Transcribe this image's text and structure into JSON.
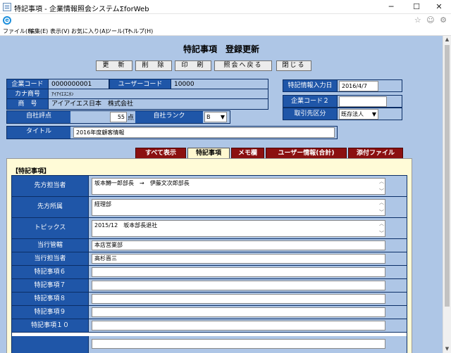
{
  "window": {
    "title": "特記事項 - 企業情報照会システムΣforWeb",
    "minimize": "─",
    "maximize": "☐",
    "close": "✕"
  },
  "browser": {
    "icons": "☆ ☺ ⚙"
  },
  "menu": [
    "ファイル(F)",
    "編集(E)",
    "表示(V)",
    "お気に入り(A)",
    "ツール(T)",
    "ヘルプ(H)"
  ],
  "page": {
    "title": "特記事項　登録更新"
  },
  "toolbar": {
    "update": "更　新",
    "delete": "削　除",
    "print": "印　刷",
    "back": "照会へ戻る",
    "close": "閉じる"
  },
  "company": {
    "code_label": "企業コード",
    "code": "0000000001",
    "user_code_label": "ユーザーコード",
    "user_code": "10000",
    "kana_label": "カナ商号",
    "kana": "ｱｲｱｲｴｽﾆﾎﾝ",
    "name_label": "商　号",
    "name": "アイアイエス日本　株式会社",
    "self_score_label": "自社評点",
    "self_score": "55",
    "score_unit": "点",
    "rank_label": "自社ランク",
    "rank": "B",
    "title_label": "タイトル",
    "title": "2016年度顧客情報"
  },
  "side": {
    "date_label": "特記情報入力日",
    "date": "2016/4/7",
    "code2_label": "企業コード２",
    "code2": "",
    "partner_label": "取引先区分",
    "partner": "既存法人"
  },
  "tabs": [
    {
      "label": "すべて表示",
      "active": false
    },
    {
      "label": "特記事項",
      "active": true
    },
    {
      "label": "メモ欄",
      "active": false
    },
    {
      "label": "ユーザー情報(合計)",
      "active": false
    },
    {
      "label": "添付ファイル",
      "active": false
    }
  ],
  "section": {
    "heading": "【特記事項】"
  },
  "rows": [
    {
      "label": "先方担当者",
      "value": "坂本鱒一郎部長　→　伊藤文次郎部長",
      "type": "textarea"
    },
    {
      "label": "先方所属",
      "value": "経理部",
      "type": "textarea"
    },
    {
      "label": "トピックス",
      "value": "2015/12　坂本部長退社",
      "type": "textarea"
    },
    {
      "label": "当行管轄",
      "value": "本店営業部",
      "type": "field"
    },
    {
      "label": "当行担当者",
      "value": "高杉晋三",
      "type": "field"
    },
    {
      "label": "特記事項６",
      "value": "",
      "type": "field"
    },
    {
      "label": "特記事項７",
      "value": "",
      "type": "field"
    },
    {
      "label": "特記事項８",
      "value": "",
      "type": "field"
    },
    {
      "label": "特記事項９",
      "value": "",
      "type": "field"
    },
    {
      "label": "特記事項１０",
      "value": "",
      "type": "field"
    }
  ]
}
